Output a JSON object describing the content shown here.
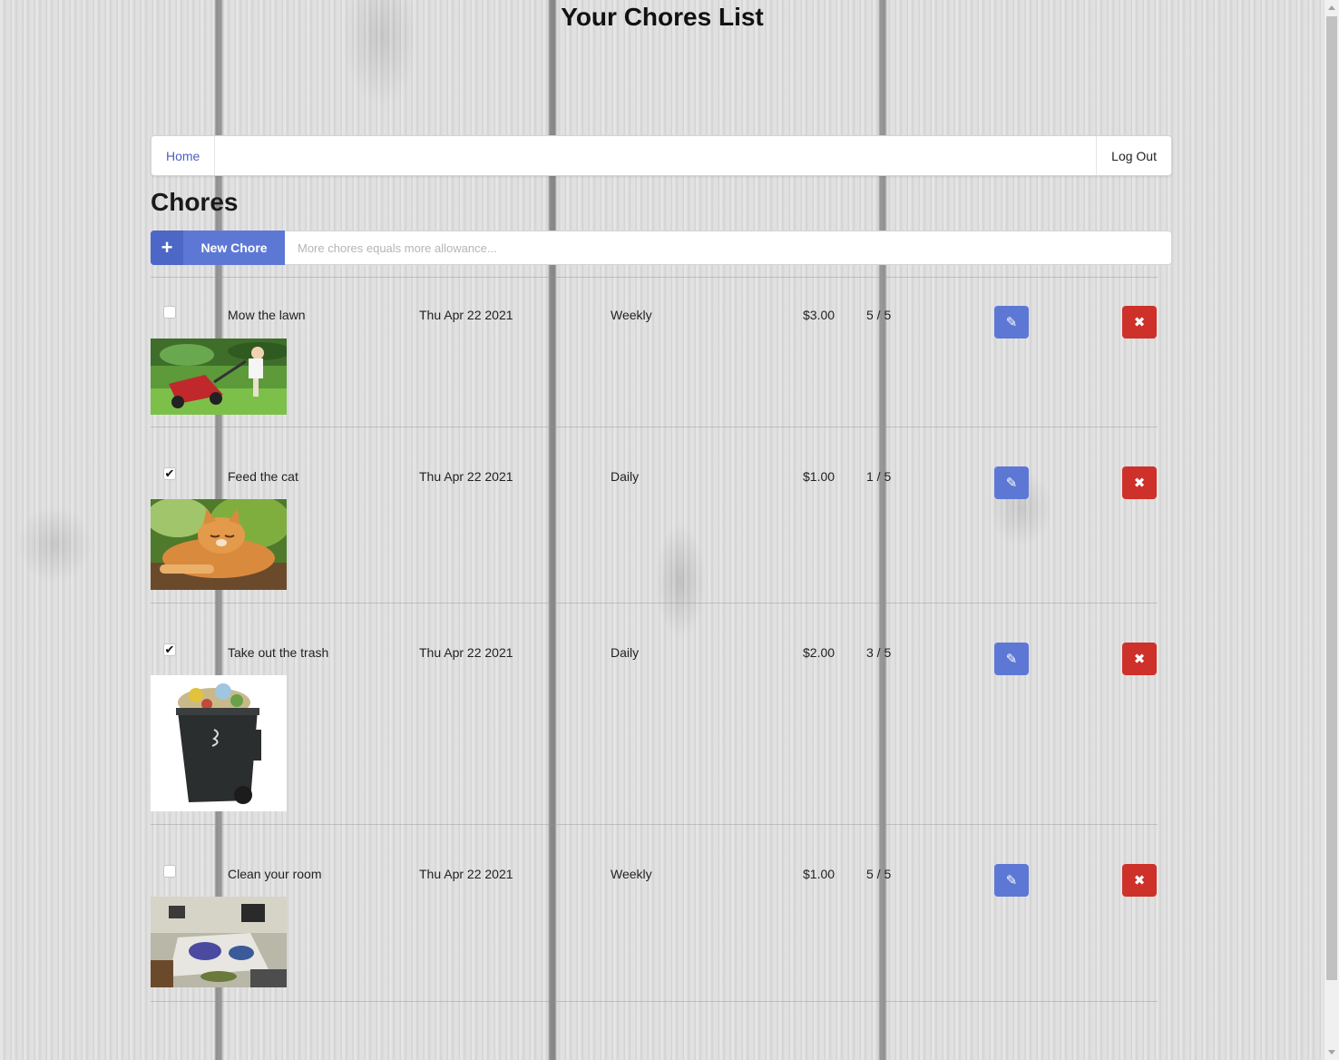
{
  "page": {
    "title": "Your Chores List"
  },
  "nav": {
    "home_label": "Home",
    "logout_label": "Log Out"
  },
  "section": {
    "title": "Chores"
  },
  "new_chore": {
    "button_label": "New Chore",
    "button_icon": "plus-icon",
    "placeholder": "More chores equals more allowance..."
  },
  "chores": [
    {
      "name": "Mow the lawn",
      "date": "Thu Apr 22 2021",
      "frequency": "Weekly",
      "price": "$3.00",
      "count": "5 / 5",
      "completed": false,
      "image": "lawn-mower-photo"
    },
    {
      "name": "Feed the cat",
      "date": "Thu Apr 22 2021",
      "frequency": "Daily",
      "price": "$1.00",
      "count": "1 / 5",
      "completed": true,
      "image": "cat-photo"
    },
    {
      "name": "Take out the trash",
      "date": "Thu Apr 22 2021",
      "frequency": "Daily",
      "price": "$2.00",
      "count": "3 / 5",
      "completed": true,
      "image": "trash-bin-photo"
    },
    {
      "name": "Clean your room",
      "date": "Thu Apr 22 2021",
      "frequency": "Weekly",
      "price": "$1.00",
      "count": "5 / 5",
      "completed": false,
      "image": "messy-room-photo"
    }
  ],
  "icons": {
    "edit": "pencil-icon",
    "delete": "close-icon",
    "checked": "check-icon"
  },
  "colors": {
    "primary": "#5d78d4",
    "danger": "#cd3129",
    "link": "#4a5fc4"
  }
}
